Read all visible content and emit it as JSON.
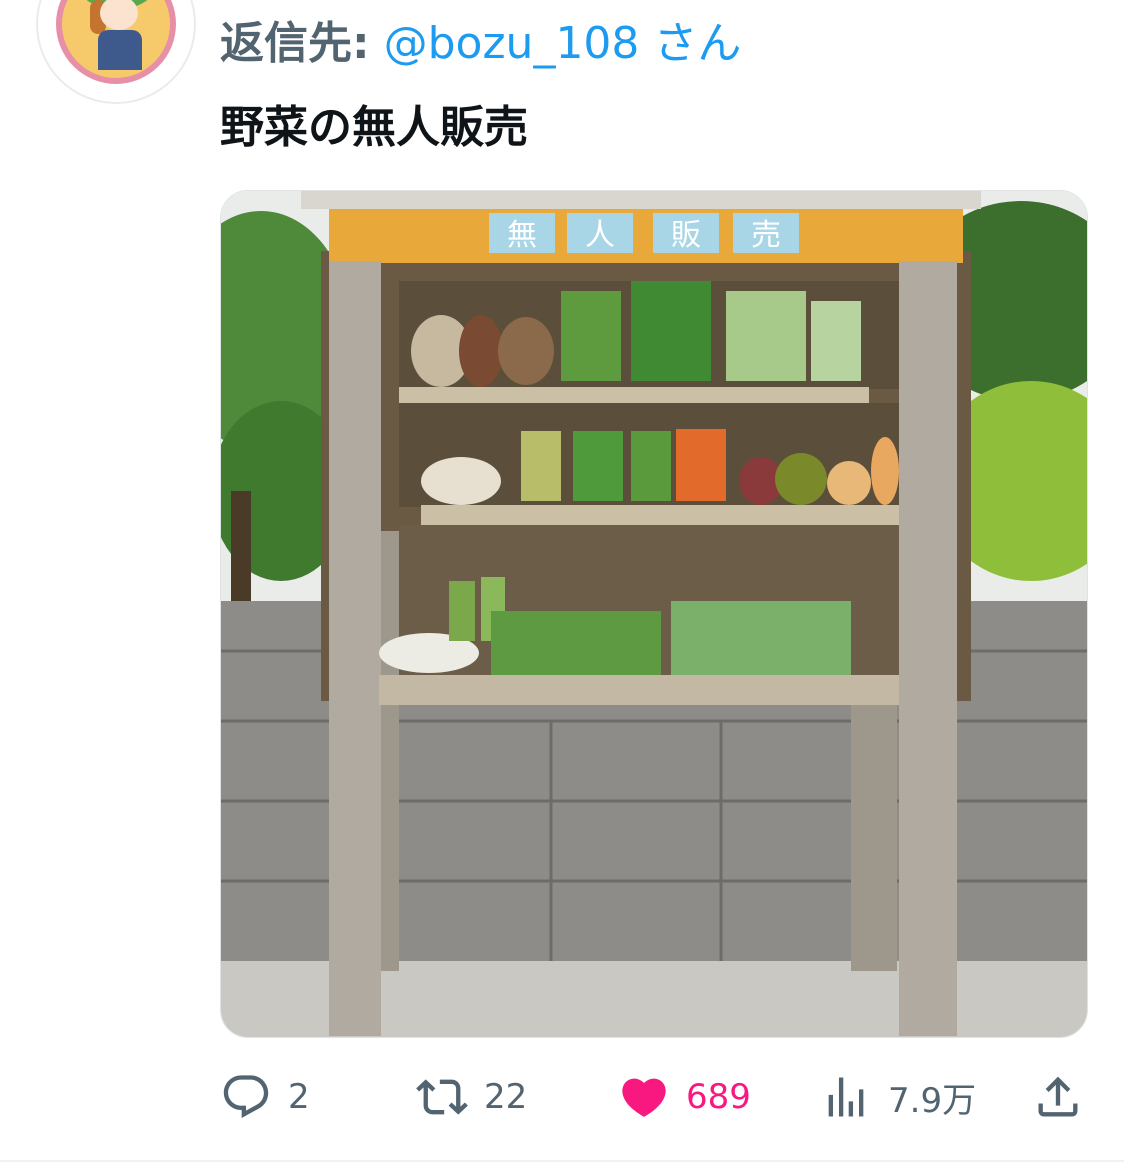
{
  "reply": {
    "prefix": "返信先:",
    "handle": "@bozu_108",
    "suffix": "さん"
  },
  "tweet": {
    "text": "野菜の無人販売",
    "image_sign": [
      "無",
      "人",
      "販",
      "売"
    ]
  },
  "actions": {
    "reply_count": "2",
    "retweet_count": "22",
    "like_count": "689",
    "views_count": "7.9万"
  },
  "colors": {
    "accent": "#1d9bf0",
    "like": "#f91880",
    "muted": "#536471"
  }
}
